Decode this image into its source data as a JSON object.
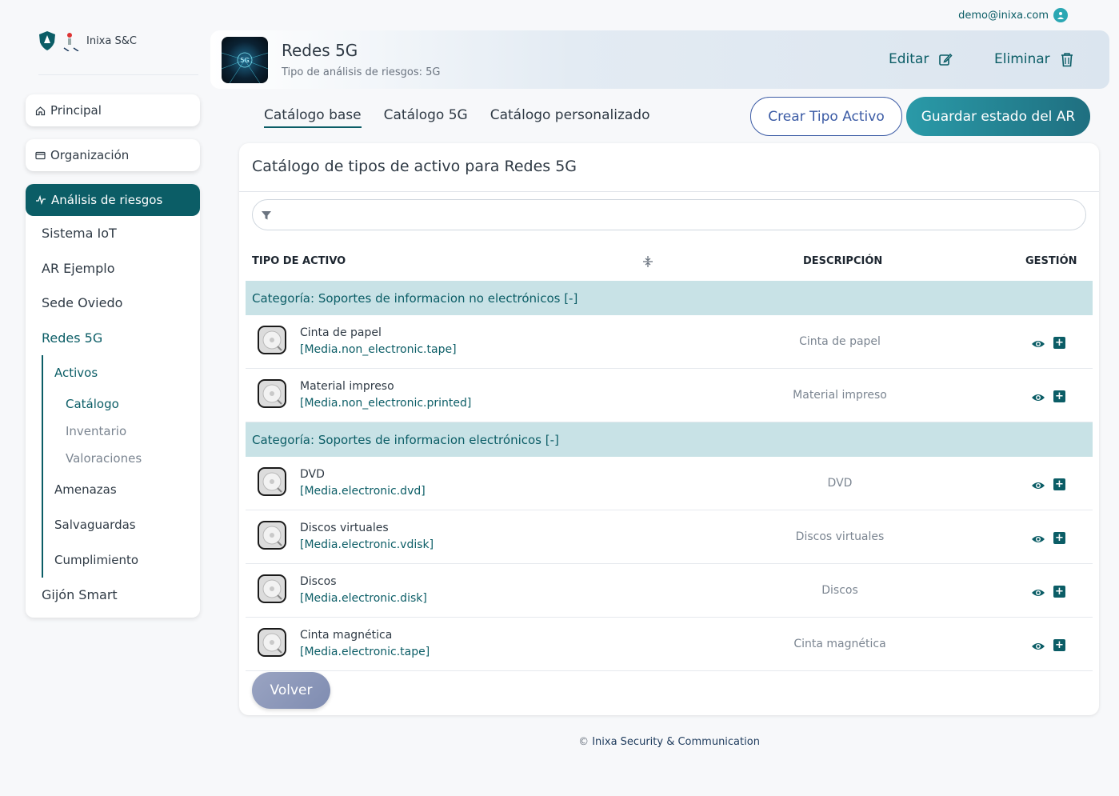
{
  "user": {
    "email": "demo@inixa.com"
  },
  "logo": {
    "text": "Inixa S&C"
  },
  "sidebar": {
    "principal": "Principal",
    "organizacion": "Organización",
    "analisis": "Análisis de riesgos",
    "projects": [
      "Sistema IoT",
      "AR Ejemplo",
      "Sede Oviedo",
      "Redes 5G"
    ],
    "tree": {
      "activos": "Activos",
      "leaves": [
        "Catálogo",
        "Inventario",
        "Valoraciones"
      ],
      "amenazas": "Amenazas",
      "salvaguardas": "Salvaguardas",
      "cumplimiento": "Cumplimiento"
    },
    "last_project": "Gijón Smart"
  },
  "header": {
    "title": "Redes 5G",
    "subtitle": "Tipo de análisis de riesgos: 5G",
    "image_label": "5G",
    "edit": "Editar",
    "delete": "Eliminar"
  },
  "tabs": [
    "Catálogo base",
    "Catálogo 5G",
    "Catálogo personalizado"
  ],
  "buttons": {
    "create": "Crear Tipo Activo",
    "save": "Guardar estado del AR",
    "back": "Volver"
  },
  "card": {
    "title": "Catálogo de tipos de activo para Redes 5G",
    "columns": {
      "tipo": "TIPO DE ACTIVO",
      "descripcion": "DESCRIPCIÓN",
      "gestion": "GESTIÓN"
    }
  },
  "categories": [
    {
      "label": "Categoría: Soportes de informacion no electrónicos [-]",
      "items": [
        {
          "name": "Cinta de papel",
          "code": "[Media.non_electronic.tape]",
          "desc": "Cinta de papel"
        },
        {
          "name": "Material impreso",
          "code": "[Media.non_electronic.printed]",
          "desc": "Material impreso"
        }
      ]
    },
    {
      "label": "Categoría: Soportes de informacion electrónicos [-]",
      "items": [
        {
          "name": "DVD",
          "code": "[Media.electronic.dvd]",
          "desc": "DVD"
        },
        {
          "name": "Discos virtuales",
          "code": "[Media.electronic.vdisk]",
          "desc": "Discos virtuales"
        },
        {
          "name": "Discos",
          "code": "[Media.electronic.disk]",
          "desc": "Discos"
        },
        {
          "name": "Cinta magnética",
          "code": "[Media.electronic.tape]",
          "desc": "Cinta magnética"
        }
      ]
    }
  ],
  "footer": {
    "copyright": "©",
    "brand": "Inixa Security & Communication"
  }
}
